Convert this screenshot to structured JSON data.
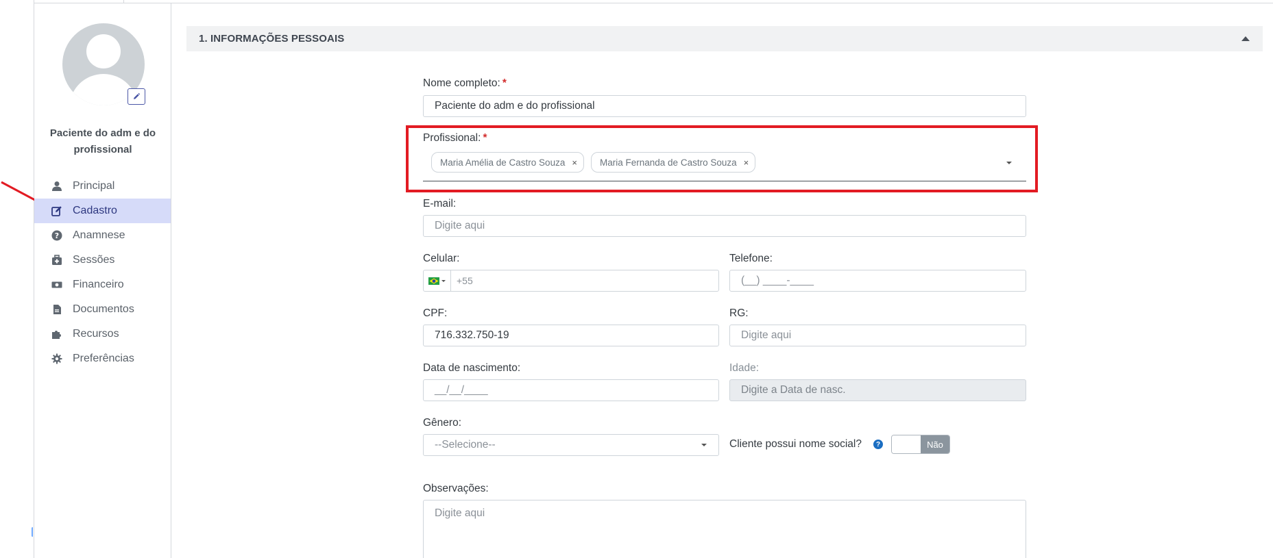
{
  "sidebar": {
    "patient_name": "Paciente do adm e do profissional",
    "items": [
      {
        "label": "Principal",
        "icon": "user-icon"
      },
      {
        "label": "Cadastro",
        "icon": "edit-icon",
        "active": true
      },
      {
        "label": "Anamnese",
        "icon": "question-circle-icon"
      },
      {
        "label": "Sessões",
        "icon": "medkit-icon"
      },
      {
        "label": "Financeiro",
        "icon": "money-icon"
      },
      {
        "label": "Documentos",
        "icon": "file-icon"
      },
      {
        "label": "Recursos",
        "icon": "puzzle-icon"
      },
      {
        "label": "Preferências",
        "icon": "gear-icon"
      }
    ]
  },
  "section": {
    "title": "1. INFORMAÇÕES PESSOAIS"
  },
  "form": {
    "nome": {
      "label": "Nome completo:",
      "required": "*",
      "value": "Paciente do adm e do profissional"
    },
    "profissional": {
      "label": "Profissional:",
      "required": "*",
      "chips": [
        "Maria Amélia de Castro Souza",
        "Maria Fernanda de Castro Souza"
      ],
      "remove_glyph": "×"
    },
    "email": {
      "label": "E-mail:",
      "placeholder": "Digite aqui"
    },
    "celular": {
      "label": "Celular:",
      "placeholder": "+55"
    },
    "telefone": {
      "label": "Telefone:",
      "placeholder": "(__) ____-____"
    },
    "cpf": {
      "label": "CPF:",
      "value": "716.332.750-19"
    },
    "rg": {
      "label": "RG:",
      "placeholder": "Digite aqui"
    },
    "nascimento": {
      "label": "Data de nascimento:",
      "placeholder": "__/__/____"
    },
    "idade": {
      "label": "Idade:",
      "placeholder": "Digite a Data de nasc."
    },
    "genero": {
      "label": "Gênero:",
      "value": "--Selecione--"
    },
    "nome_social": {
      "label": "Cliente possui nome social?",
      "help": "?",
      "toggle_label": "Não",
      "toggle_on": false
    },
    "observacoes": {
      "label": "Observações:",
      "placeholder": "Digite aqui"
    }
  },
  "colors": {
    "accent": "#2e3880",
    "active_bg": "#d6dbf9",
    "highlight_border": "#e21b23",
    "required": "#d32f2f"
  }
}
